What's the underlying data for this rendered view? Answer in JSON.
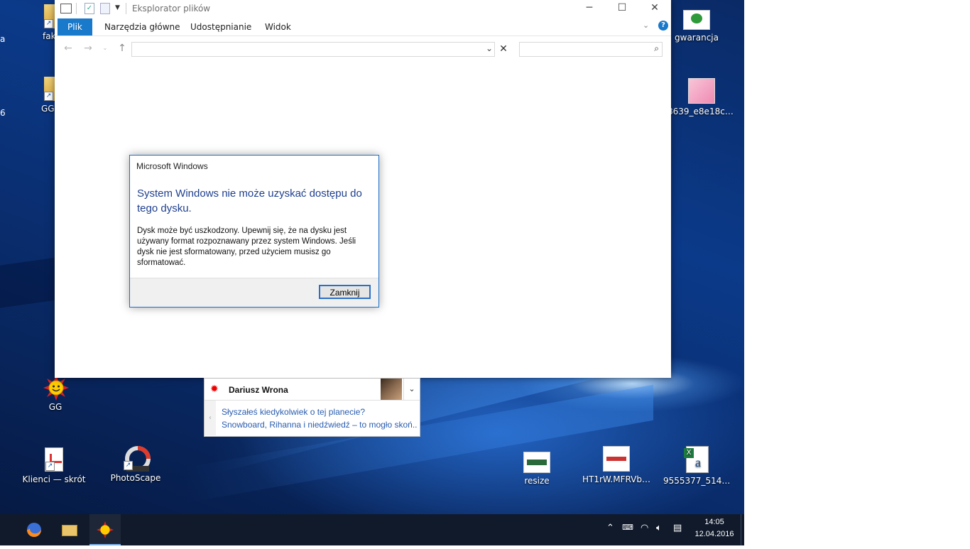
{
  "desktop": {
    "icons_left": [
      {
        "label": "fak",
        "icon": "folder-shortcut-icon"
      },
      {
        "label": "GG",
        "icon": "gg-folder-shortcut-icon"
      },
      {
        "label": "GG",
        "icon": "gg-sun-icon"
      },
      {
        "label": "Klienci — skrót",
        "icon": "document-shortcut-icon"
      },
      {
        "label": "PhotoScape",
        "icon": "photoscape-icon"
      }
    ],
    "icons_right": [
      {
        "label": "gwarancja",
        "icon": "image-file-icon"
      },
      {
        "label": "8639_e8e18cba8...",
        "icon": "image-file-icon"
      },
      {
        "label": "resize",
        "icon": "image-file-icon"
      },
      {
        "label": "HT1rW.MFRVbXX...",
        "icon": "image-file-icon"
      },
      {
        "label": "9555377_514981",
        "icon": "excel-file-icon"
      }
    ],
    "edge_text": [
      "a",
      "6"
    ]
  },
  "explorer": {
    "title": "Eksplorator plików",
    "tabs": [
      "Plik",
      "Narzędzia główne",
      "Udostępnianie",
      "Widok"
    ],
    "address_value": "",
    "search_value": ""
  },
  "dialog": {
    "title": "Microsoft Windows",
    "heading": "System Windows nie może uzyskać dostępu do tego dysku.",
    "body": "Dysk może być uszkodzony. Upewnij się, że na dysku jest używany format rozpoznawany przez system Windows. Jeśli dysk nie jest sformatowany, przed użyciem musisz go sformatować.",
    "button": "Zamknij"
  },
  "notification": {
    "sender": "Dariusz Wrona",
    "line1": "Słyszałeś kiedykolwiek o tej planecie?",
    "line2": "Snowboard, Rihanna i niedźwiedź – to mogło skoń..."
  },
  "taskbar": {
    "time": "14:05",
    "date": "12.04.2016"
  },
  "colors": {
    "accent": "#1979ca",
    "dialog_heading": "#1e3f8f",
    "link": "#2a5db0",
    "taskbar": "#101a2b"
  }
}
